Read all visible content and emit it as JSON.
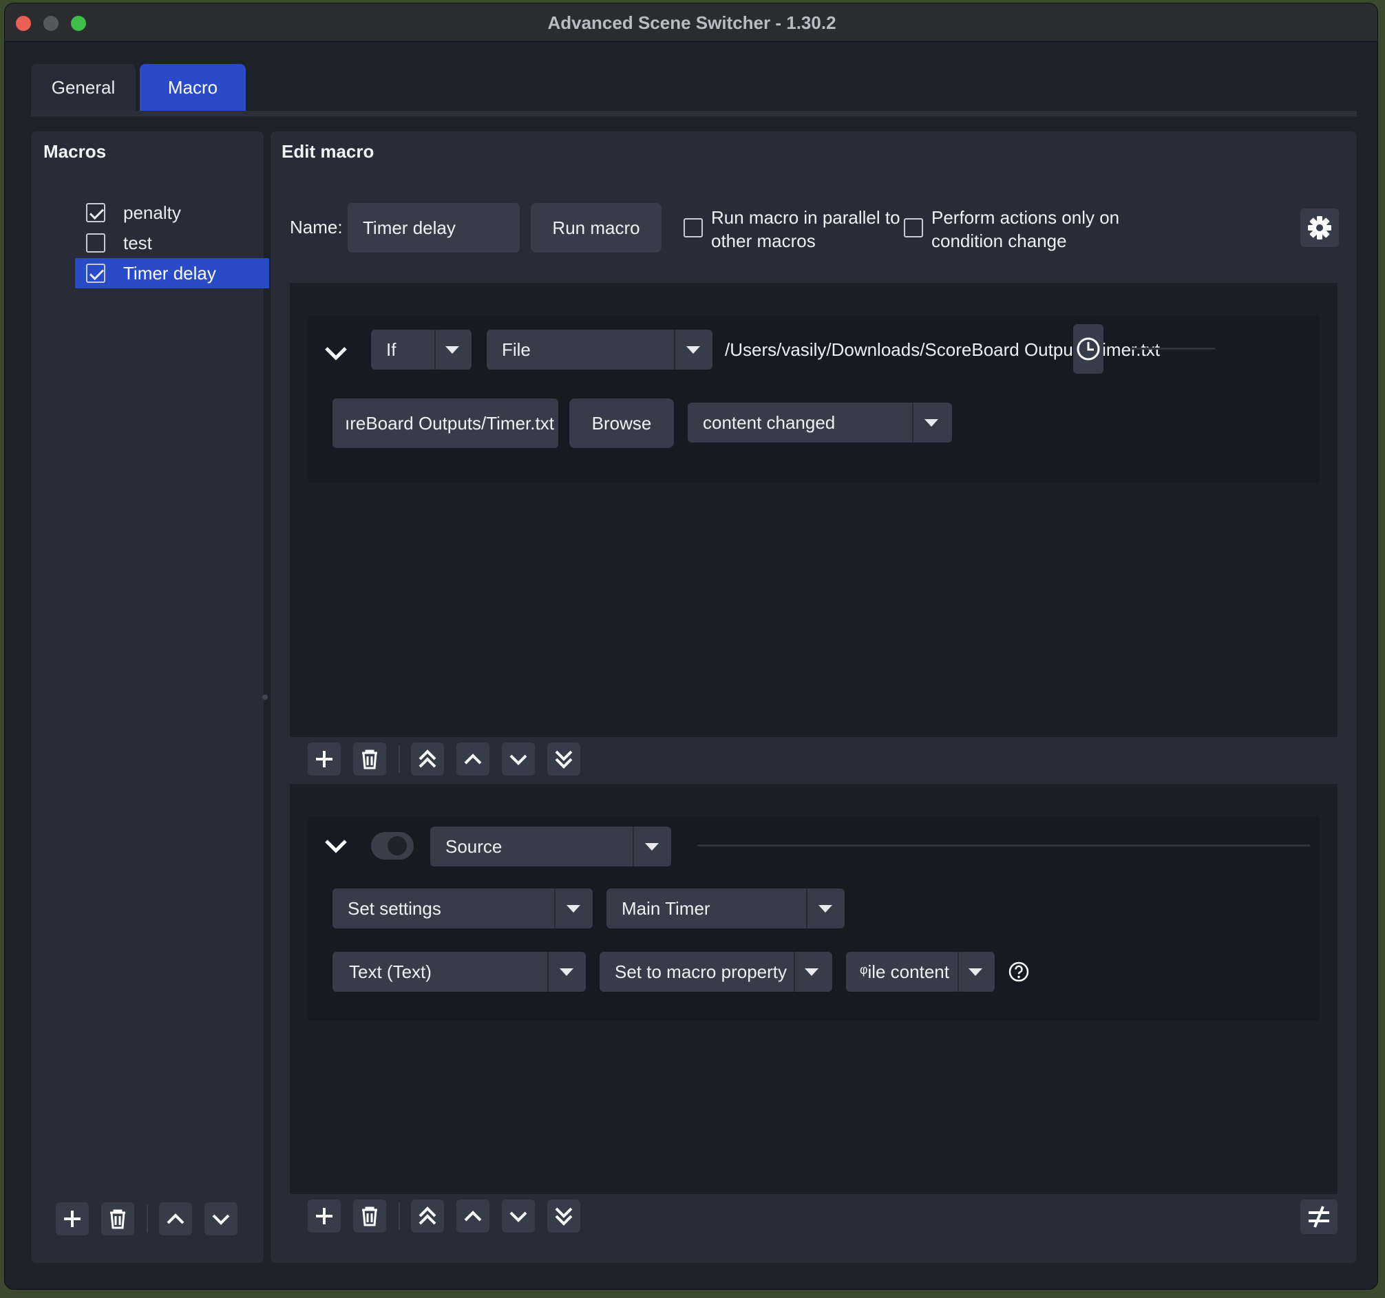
{
  "window": {
    "title": "Advanced Scene Switcher - 1.30.2"
  },
  "tabs": [
    {
      "label": "General",
      "active": false
    },
    {
      "label": "Macro",
      "active": true
    }
  ],
  "colors": {
    "accent": "#2a4bc7",
    "panel": "#272c38",
    "control": "#363c4a"
  },
  "macros_panel": {
    "title": "Macros",
    "items": [
      {
        "label": "penalty",
        "checked": true,
        "selected": false
      },
      {
        "label": "test",
        "checked": false,
        "selected": false
      },
      {
        "label": "Timer delay",
        "checked": true,
        "selected": true
      }
    ]
  },
  "edit_panel": {
    "title": "Edit macro",
    "name_label": "Name:",
    "name_value": "Timer delay",
    "run_button": "Run macro",
    "parallel_checkbox": {
      "line1": "Run macro in parallel to",
      "line2": "other macros",
      "checked": false
    },
    "condition_change_checkbox": {
      "line1": "Perform actions only on",
      "line2": "condition change",
      "checked": false
    }
  },
  "condition": {
    "logic": "If",
    "type": "File",
    "path_display": "/Users/vasily/Downloads/ScoreBoard Outputs/Timer.txt",
    "path_field": "ıreBoard Outputs/Timer.txt",
    "browse_button": "Browse",
    "check_type": "content changed"
  },
  "action": {
    "type": "Source",
    "enabled": false,
    "action_kind": "Set settings",
    "source_name": "Main Timer",
    "setting": "Text (Text)",
    "mode": "Set to macro property",
    "property": "ᵠile content"
  }
}
